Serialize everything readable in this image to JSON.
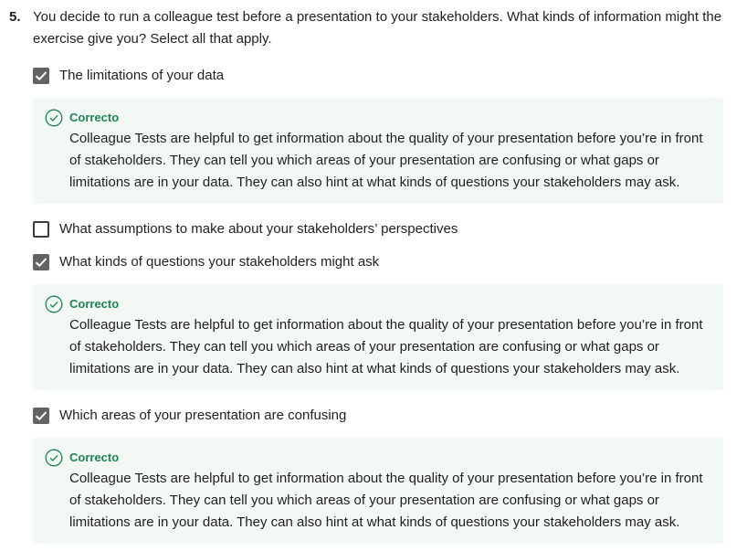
{
  "question": {
    "number": "5.",
    "text": "You decide to run a colleague test before a presentation to your stakeholders. What kinds of information might the exercise give you? Select all that apply."
  },
  "options": [
    {
      "label": "The limitations of your data",
      "checked": true
    },
    {
      "label": "What assumptions to make about your stakeholders’ perspectives",
      "checked": false
    },
    {
      "label": "What kinds of questions your stakeholders might ask",
      "checked": true
    },
    {
      "label": "Which areas of your presentation are confusing",
      "checked": true
    }
  ],
  "feedback": [
    {
      "title": "Correcto",
      "text": "Colleague Tests are helpful to get information about the quality of your presentation before you’re in front of stakeholders. They can tell you which areas of your presentation are confusing or what gaps or limitations are in your data. They can also hint at what kinds of questions your stakeholders may ask."
    },
    {
      "title": "Correcto",
      "text": "Colleague Tests are helpful to get information about the quality of your presentation before you’re in front of stakeholders. They can tell you which areas of your presentation are confusing or what gaps or limitations are in your data. They can also hint at what kinds of questions your stakeholders may ask."
    },
    {
      "title": "Correcto",
      "text": "Colleague Tests are helpful to get information about the quality of your presentation before you’re in front of stakeholders. They can tell you which areas of your presentation are confusing or what gaps or limitations are in your data. They can also hint at what kinds of questions your stakeholders may ask."
    }
  ],
  "icons": {
    "checked": "checkmark-icon",
    "correct": "check-circle-icon"
  },
  "colors": {
    "checkbox_fill": "#636363",
    "correct_green": "#1f8354",
    "feedback_bg": "#f2f9f5"
  }
}
